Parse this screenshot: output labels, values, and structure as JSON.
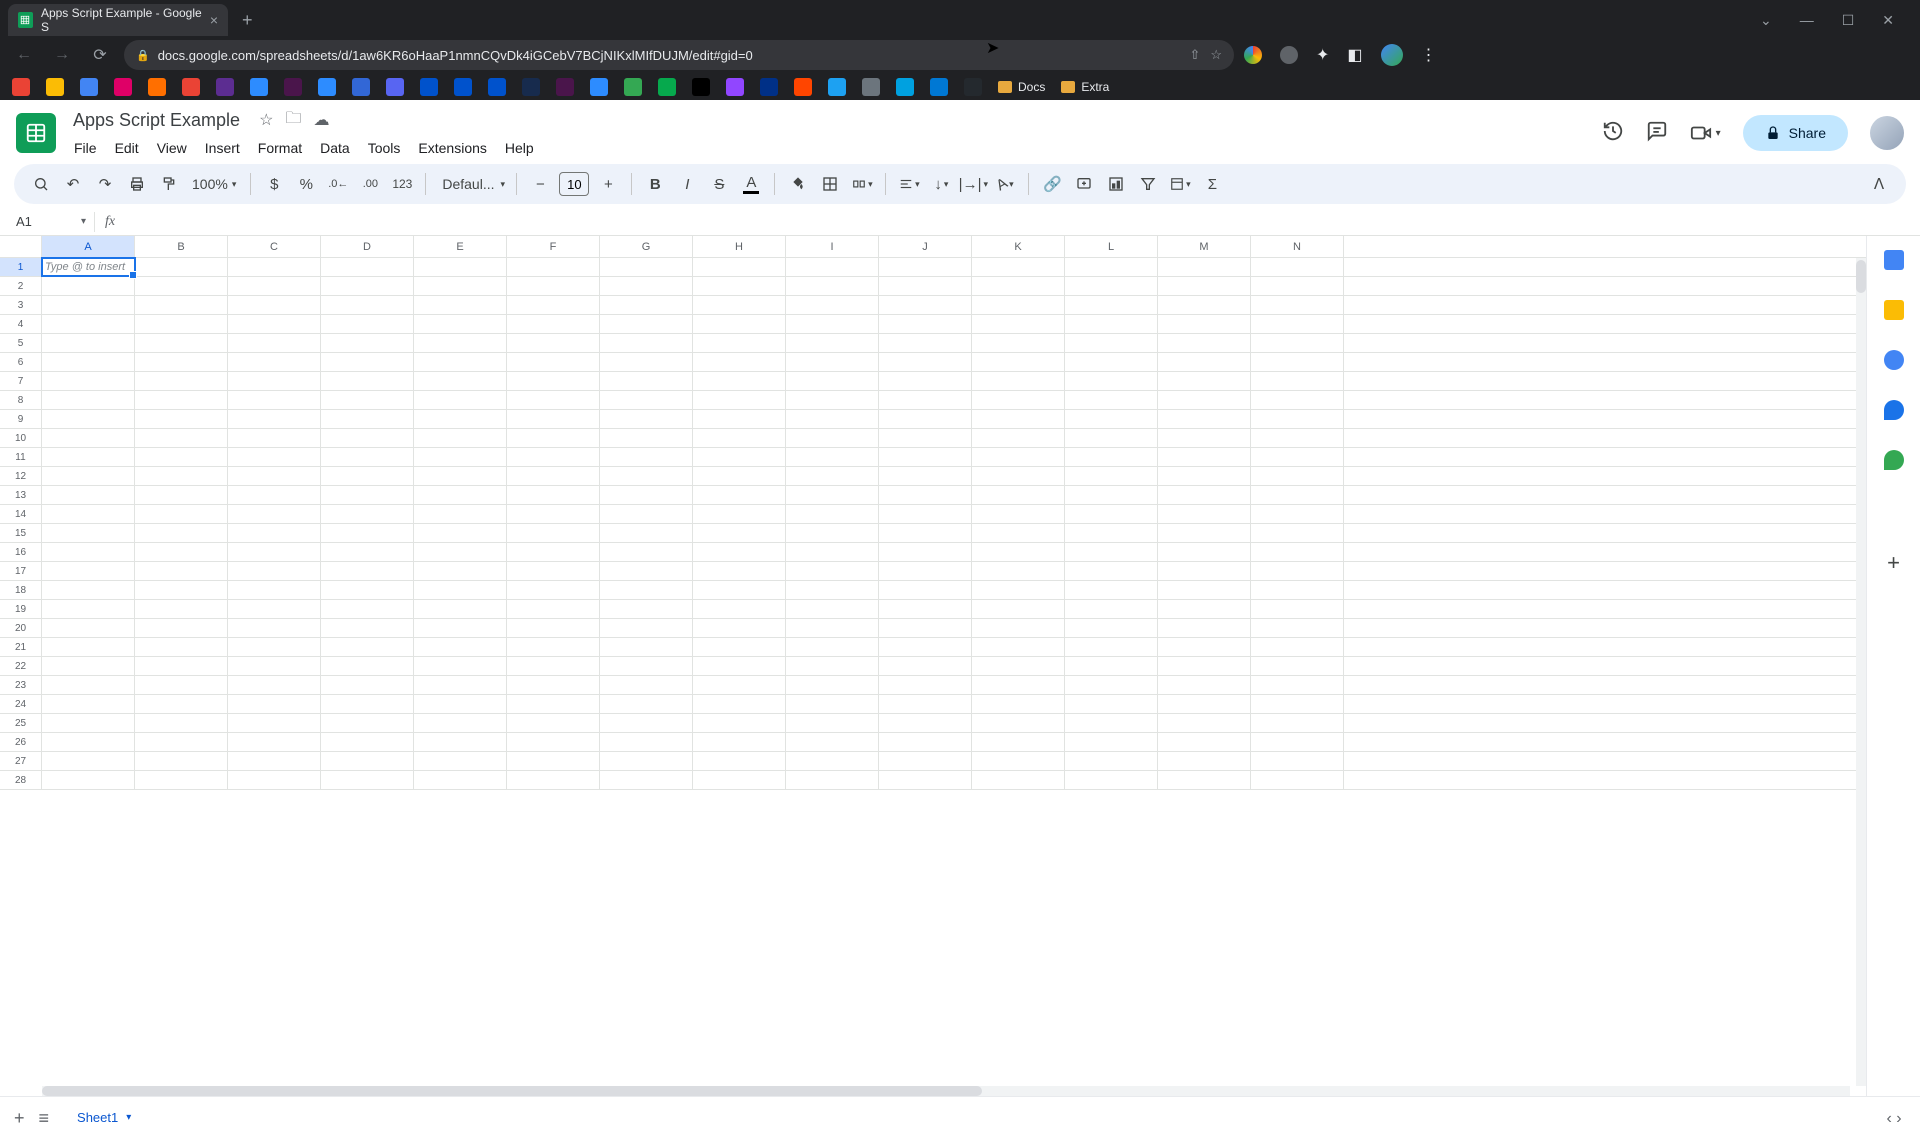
{
  "browser": {
    "tab_title": "Apps Script Example - Google S",
    "url_display": "docs.google.com/spreadsheets/d/1aw6KR6oHaaP1nmnCQvDk4iGCebV7BCjNIKxlMIfDUJM/edit#gid=0",
    "bookmarks_folders": [
      "Docs",
      "Extra"
    ]
  },
  "doc": {
    "title": "Apps Script Example",
    "menus": [
      "File",
      "Edit",
      "View",
      "Insert",
      "Format",
      "Data",
      "Tools",
      "Extensions",
      "Help"
    ],
    "share_label": "Share"
  },
  "toolbar": {
    "zoom": "100%",
    "font": "Defaul...",
    "font_size": "10",
    "format_123": "123"
  },
  "namebox": "A1",
  "formula": "",
  "columns": [
    "A",
    "B",
    "C",
    "D",
    "E",
    "F",
    "G",
    "H",
    "I",
    "J",
    "K",
    "L",
    "M",
    "N"
  ],
  "row_count": 28,
  "active_cell": {
    "row": 1,
    "col": "A",
    "placeholder": "Type @ to insert"
  },
  "sheet_tabs": [
    "Sheet1"
  ],
  "active_sheet": "Sheet1"
}
